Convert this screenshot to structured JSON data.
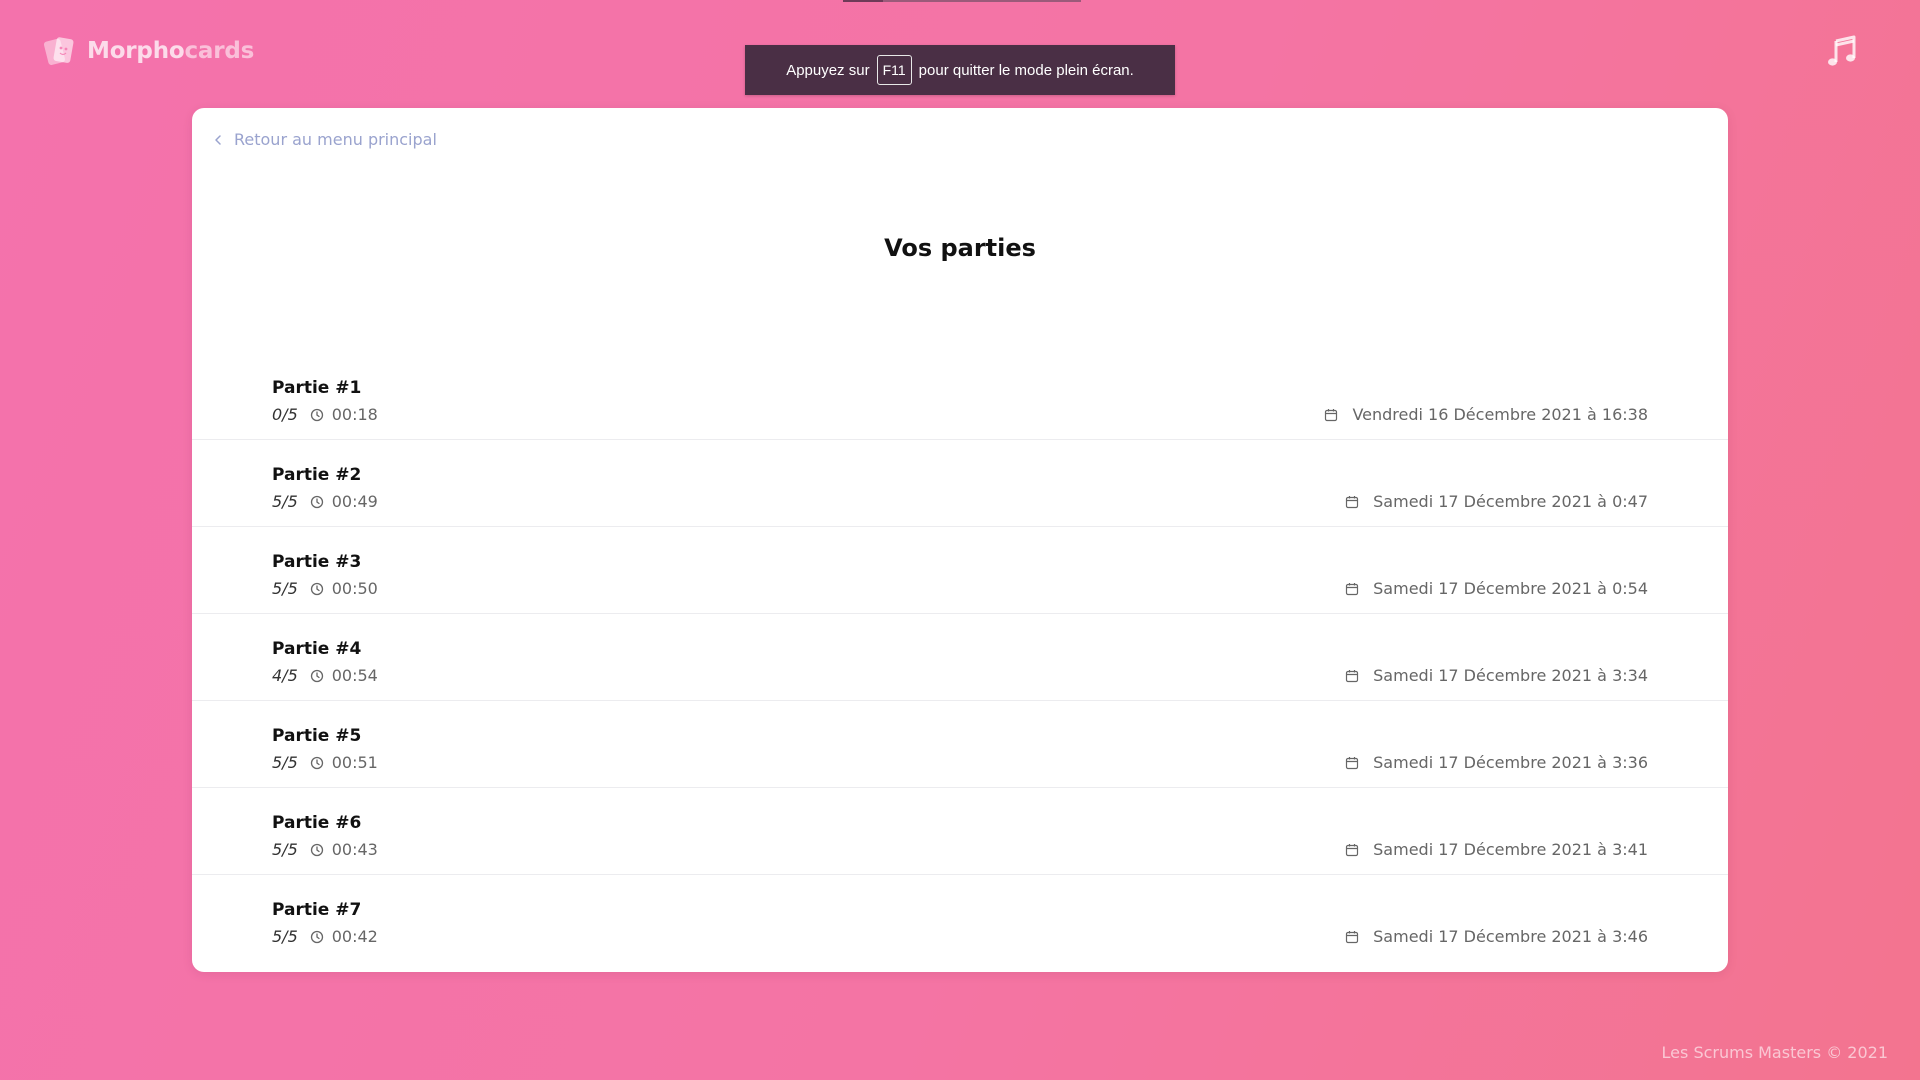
{
  "app": {
    "logo_part1": "Morpho",
    "logo_part2": "cards"
  },
  "fullscreen_banner": {
    "before": "Appuyez sur",
    "key": "F11",
    "after": "pour quitter le mode plein écran."
  },
  "page": {
    "back_label": "Retour au menu principal",
    "title": "Vos parties"
  },
  "games": [
    {
      "name": "Partie #1",
      "score": "0/5",
      "time": "00:18",
      "date": "Vendredi 16 Décembre 2021 à 16:38"
    },
    {
      "name": "Partie #2",
      "score": "5/5",
      "time": "00:49",
      "date": "Samedi 17 Décembre 2021 à 0:47"
    },
    {
      "name": "Partie #3",
      "score": "5/5",
      "time": "00:50",
      "date": "Samedi 17 Décembre 2021 à 0:54"
    },
    {
      "name": "Partie #4",
      "score": "4/5",
      "time": "00:54",
      "date": "Samedi 17 Décembre 2021 à 3:34"
    },
    {
      "name": "Partie #5",
      "score": "5/5",
      "time": "00:51",
      "date": "Samedi 17 Décembre 2021 à 3:36"
    },
    {
      "name": "Partie #6",
      "score": "5/5",
      "time": "00:43",
      "date": "Samedi 17 Décembre 2021 à 3:41"
    },
    {
      "name": "Partie #7",
      "score": "5/5",
      "time": "00:42",
      "date": "Samedi 17 Décembre 2021 à 3:46"
    }
  ],
  "footer": {
    "text": "Les Scrums Masters © 2021"
  },
  "icons": {
    "logo": "cards-logo-icon",
    "music": "music-note-icon",
    "back": "chevron-left-icon",
    "time": "clock-icon",
    "date": "calendar-icon"
  },
  "colors": {
    "background_start": "#f472ac",
    "background_end": "#f3748f",
    "card": "#ffffff",
    "banner": "#4a2f45",
    "link": "#9aa3ce"
  }
}
